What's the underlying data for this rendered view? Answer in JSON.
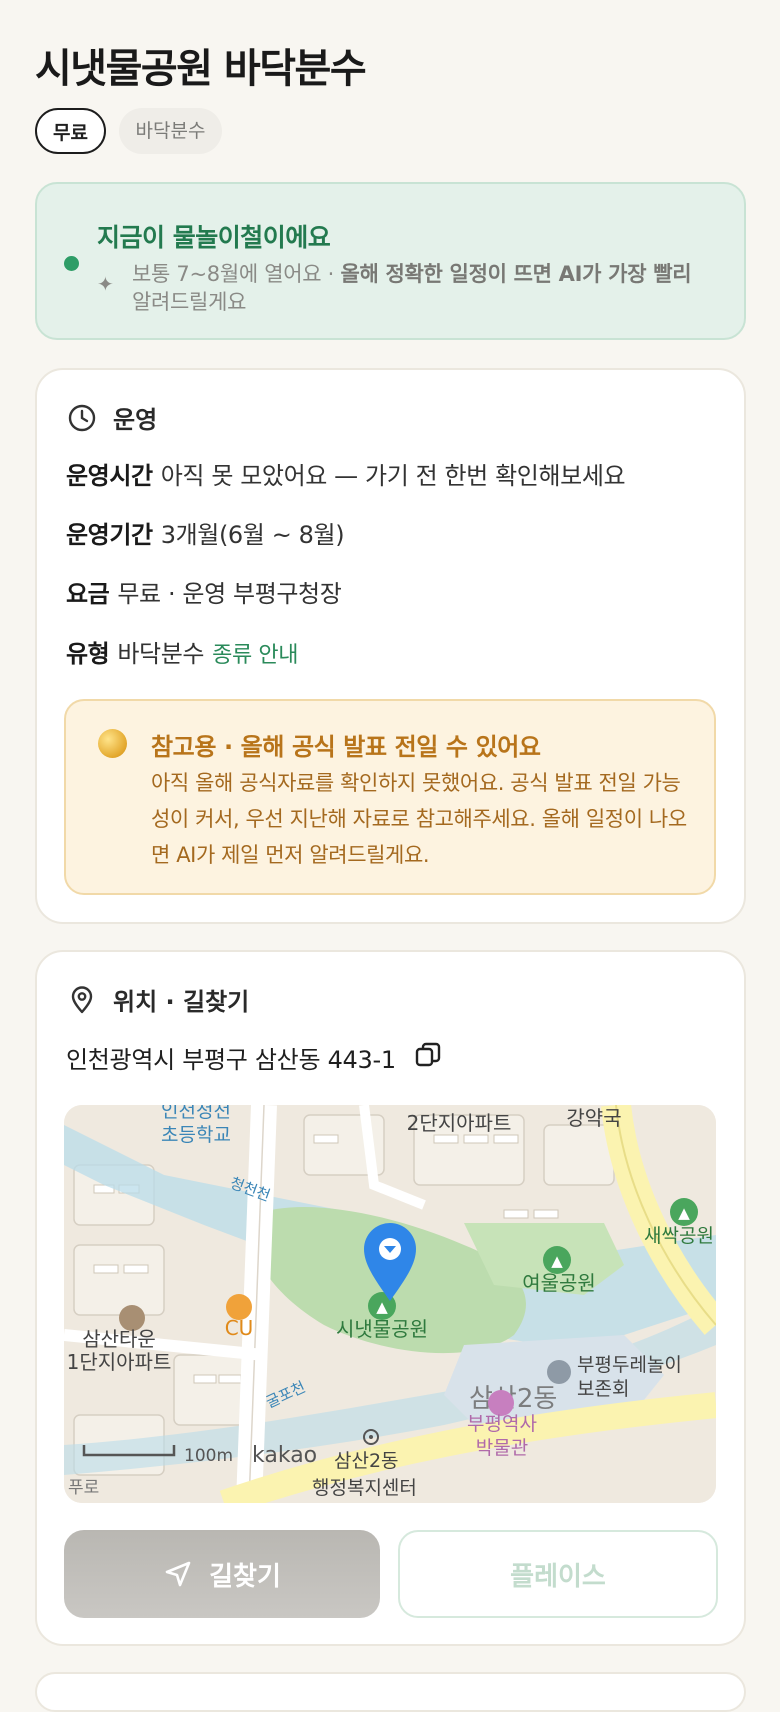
{
  "page": {
    "title": "시냇물공원 바닥분수"
  },
  "tags": [
    "무료",
    "바닥분수"
  ],
  "season": {
    "title": "지금이 물놀이철이에요",
    "desc_plain": "보통 7~8월에 열어요 · ",
    "desc_bold": "올해 정확한 일정이 뜨면 AI가 가장 빨리",
    "desc_tail": "알려드릴게요"
  },
  "operation": {
    "header": "운영",
    "rows": [
      {
        "label": "운영시간",
        "value": "아직 못 모았어요 — 가기 전 한번 확인해보세요"
      },
      {
        "label": "운영기간",
        "value": "3개월(6월 ~ 8월)"
      },
      {
        "label": "요금",
        "value": "무료 · 운영 부평구청장"
      },
      {
        "label": "유형",
        "value": "바닥분수",
        "link": "종류 안내"
      }
    ],
    "notice": {
      "title": "참고용 · 올해 공식 발표 전일 수 있어요",
      "body": "아직 올해 공식자료를 확인하지 못했어요. 공식 발표 전일 가능성이 커서, 우선 지난해 자료로 참고해주세요. 올해 일정이 나오면 AI가 제일 먼저 알려드릴게요."
    }
  },
  "location": {
    "header": "위치 · 길찾기",
    "address": "인천광역시 부평구 삼산동 443-1",
    "map": {
      "labels": {
        "school": "인천청천\n초등학교",
        "apt2": "2단지아파트",
        "gangyak": "강약국",
        "cheongcheon": "청천천",
        "saessak": "새싹공원",
        "yeoul": "여울공원",
        "sinaet": "시냇물공원",
        "cu": "CU",
        "samsan_town": "삼산타운",
        "apt1": "1단지아파트",
        "bupyeong_duresal": "부평두레놀이",
        "bojonhoe": "보존회",
        "samsan2dong_big": "삼산2동",
        "museum_1": "부평역사",
        "museum_2": "박물관",
        "gulpocheon": "굴포천",
        "scale": "100m",
        "kakao": "kakao",
        "samsan2dong_center_1": "삼산2동",
        "samsan2dong_center_2": "행정복지센터",
        "pro": "푸로"
      }
    },
    "buttons": {
      "route": "길찾기",
      "place": "플레이스"
    }
  }
}
